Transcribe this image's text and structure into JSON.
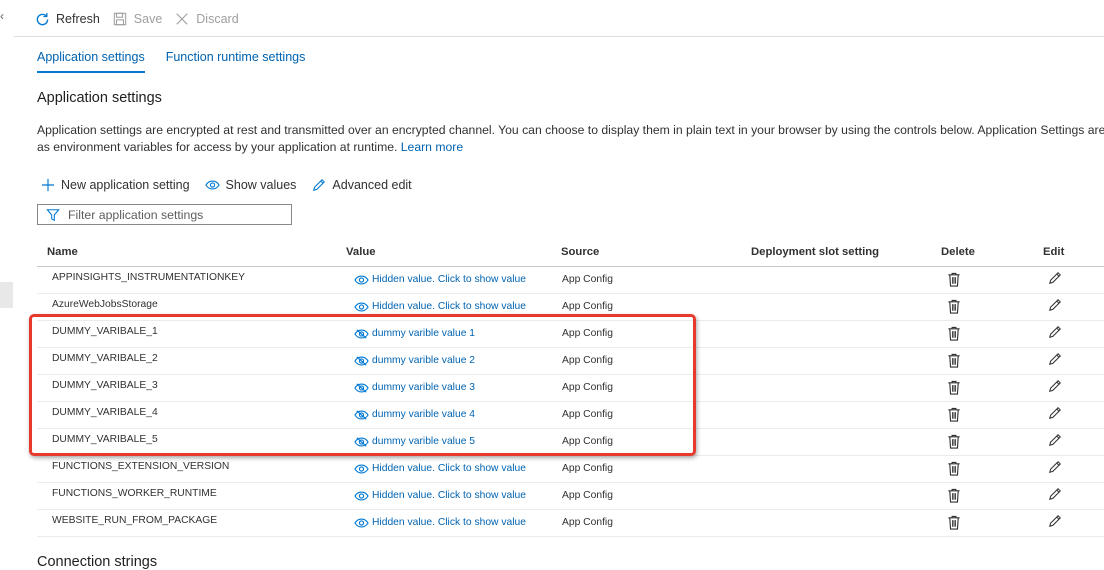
{
  "command_bar": {
    "refresh": "Refresh",
    "save": "Save",
    "discard": "Discard"
  },
  "tabs": [
    {
      "label": "Application settings",
      "active": true
    },
    {
      "label": "Function runtime settings",
      "active": false
    }
  ],
  "app_settings": {
    "heading": "Application settings",
    "description_line1": "Application settings are encrypted at rest and transmitted over an encrypted channel. You can choose to display them in plain text in your browser by using the controls below. Application Settings are expo",
    "description_line2": "as environment variables for access by your application at runtime.",
    "learn_more": "Learn more"
  },
  "toolbar": {
    "new_setting": "New application setting",
    "show_values": "Show values",
    "advanced_edit": "Advanced edit"
  },
  "filter": {
    "placeholder": "Filter application settings"
  },
  "table": {
    "headers": {
      "name": "Name",
      "value": "Value",
      "source": "Source",
      "slot": "Deployment slot setting",
      "delete": "Delete",
      "edit": "Edit"
    },
    "rows": [
      {
        "name": "APPINSIGHTS_INSTRUMENTATIONKEY",
        "value": "Hidden value. Click to show value",
        "source": "App Config",
        "revealed": false
      },
      {
        "name": "AzureWebJobsStorage",
        "value": "Hidden value. Click to show value",
        "source": "App Config",
        "revealed": false
      },
      {
        "name": "DUMMY_VARIBALE_1",
        "value": "dummy varible value 1",
        "source": "App Config",
        "revealed": true
      },
      {
        "name": "DUMMY_VARIBALE_2",
        "value": "dummy varible value 2",
        "source": "App Config",
        "revealed": true
      },
      {
        "name": "DUMMY_VARIBALE_3",
        "value": "dummy varible value 3",
        "source": "App Config",
        "revealed": true
      },
      {
        "name": "DUMMY_VARIBALE_4",
        "value": "dummy varible value 4",
        "source": "App Config",
        "revealed": true
      },
      {
        "name": "DUMMY_VARIBALE_5",
        "value": "dummy varible value 5",
        "source": "App Config",
        "revealed": true
      },
      {
        "name": "FUNCTIONS_EXTENSION_VERSION",
        "value": "Hidden value. Click to show value",
        "source": "App Config",
        "revealed": false
      },
      {
        "name": "FUNCTIONS_WORKER_RUNTIME",
        "value": "Hidden value. Click to show value",
        "source": "App Config",
        "revealed": false
      },
      {
        "name": "WEBSITE_RUN_FROM_PACKAGE",
        "value": "Hidden value. Click to show value",
        "source": "App Config",
        "revealed": false
      }
    ]
  },
  "connection_strings": {
    "heading": "Connection strings"
  },
  "colors": {
    "accent": "#0078d4",
    "link": "#0063b1",
    "highlight": "#e8392d",
    "text": "#323130",
    "disabled": "#a19f9d"
  },
  "icons": {
    "refresh": "refresh-icon",
    "save": "save-icon",
    "discard": "close-icon",
    "add": "plus-icon",
    "show": "eye-icon",
    "edit": "pencil-icon",
    "filter": "filter-icon",
    "delete": "trash-icon",
    "hidden_value": "eye-icon",
    "revealed_value": "eye-slash-icon"
  }
}
